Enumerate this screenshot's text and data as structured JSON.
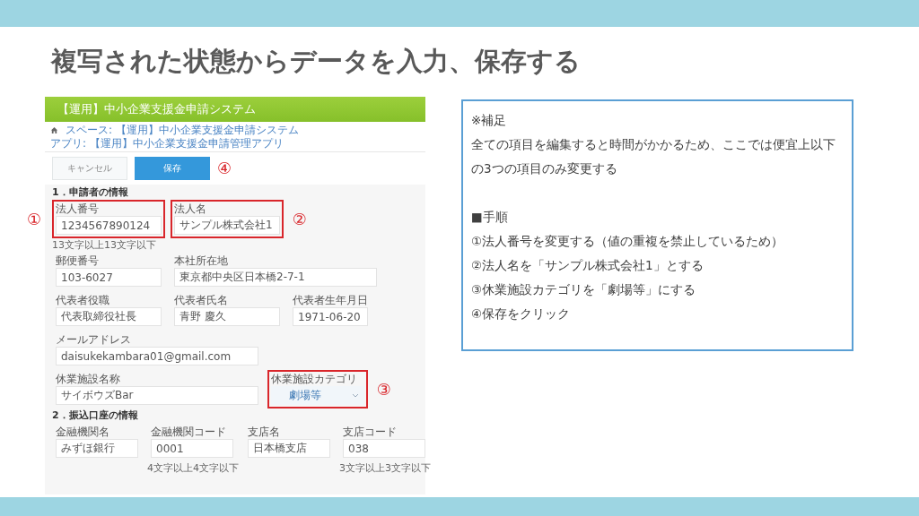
{
  "slide": {
    "title": "複写された状態からデータを入力、保存する"
  },
  "app": {
    "header": "【運用】中小企業支援金申請システム",
    "breadcrumb": [
      "スペース: 【運用】中小企業支援金申請システム",
      "アプリ: 【運用】中小企業支援金申請管理アプリ"
    ],
    "buttons": [
      {
        "label": "キャンセル",
        "kind": "secondary"
      },
      {
        "label": "保存",
        "kind": "primary",
        "marker": "④"
      }
    ],
    "sections": [
      {
        "heading": "1．申請者の情報",
        "rows": [
          {
            "fields": [
              {
                "label": "法人番号",
                "value": "1234567890124",
                "kind": "short",
                "hint": "13文字以上13文字以下",
                "highlighted": true,
                "marker": "①"
              },
              {
                "label": "法人名",
                "value": "サンプル株式会社1",
                "kind": "short",
                "highlighted": true,
                "marker": "②"
              }
            ]
          },
          {
            "fields": [
              {
                "label": "郵便番号",
                "value": "103-6027",
                "kind": "short",
                "highlighted": false
              },
              {
                "label": "本社所在地",
                "value": "東京都中央区日本橋2-7-1",
                "kind": "wide",
                "highlighted": false
              }
            ]
          },
          {
            "fields": [
              {
                "label": "代表者役職",
                "value": "代表取締役社長",
                "kind": "short",
                "highlighted": false
              },
              {
                "label": "代表者氏名",
                "value": "青野 慶久",
                "kind": "short",
                "highlighted": false
              },
              {
                "label": "代表者生年月日",
                "value": "1971-06-20",
                "kind": "date",
                "highlighted": false
              }
            ]
          },
          {
            "fields": [
              {
                "label": "メールアドレス",
                "value": "daisukekambara01@gmail.com",
                "kind": "wide",
                "highlighted": false
              }
            ]
          },
          {
            "fields": [
              {
                "label": "休業施設名称",
                "value": "サイボウズBar",
                "kind": "wide",
                "highlighted": false
              },
              {
                "label": "休業施設カテゴリ",
                "value": "劇場等",
                "kind": "select",
                "highlighted": true,
                "marker": "③"
              }
            ]
          }
        ]
      },
      {
        "heading": "2．振込口座の情報",
        "rows": [
          {
            "fields": [
              {
                "label": "金融機関名",
                "value": "みずほ銀行",
                "kind": "bank",
                "highlighted": false
              },
              {
                "label": "金融機関コード",
                "value": "0001",
                "kind": "bank",
                "hint": "4文字以上4文字以下",
                "highlighted": false
              },
              {
                "label": "支店名",
                "value": "日本橋支店",
                "kind": "bank",
                "highlighted": false
              },
              {
                "label": "支店コード",
                "value": "038",
                "kind": "bank",
                "hint": "3文字以上3文字以下",
                "highlighted": false
              }
            ]
          }
        ]
      }
    ]
  },
  "note": {
    "lines": [
      {
        "kind": "text",
        "text": "※補足"
      },
      {
        "kind": "text",
        "text": "全ての項目を編集すると時間がかかるため、ここでは便宜上以下の3つの項目のみ変更する"
      },
      {
        "kind": "gap"
      },
      {
        "kind": "text",
        "text": "■手順"
      },
      {
        "kind": "text",
        "text": "①法人番号を変更する（値の重複を禁止しているため）"
      },
      {
        "kind": "text",
        "text": "②法人名を「サンプル株式会社1」とする"
      },
      {
        "kind": "text",
        "text": "③休業施設カテゴリを「劇場等」にする"
      },
      {
        "kind": "text",
        "text": "④保存をクリック"
      }
    ]
  }
}
